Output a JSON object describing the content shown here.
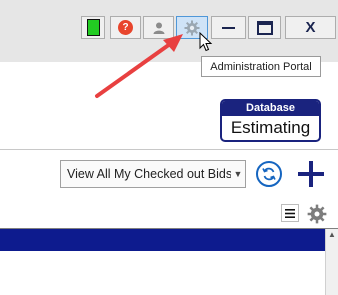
{
  "titlebar": {
    "buttons": {
      "status": {
        "color": "#22cc22"
      },
      "help": {
        "glyph": "?",
        "color": "#e8452c"
      },
      "user": {
        "icon": "user-icon"
      },
      "admin": {
        "icon": "gear-icon"
      },
      "minimize": {
        "glyph": "—"
      },
      "maximize": {
        "icon": "window-icon"
      },
      "close": {
        "glyph": "X"
      }
    }
  },
  "tooltip": {
    "text": "Administration Portal"
  },
  "database": {
    "header": "Database",
    "value": "Estimating"
  },
  "toolbar": {
    "view_select": {
      "selected": "View All My Checked out Bids"
    },
    "refresh_icon": "refresh-icon",
    "add_icon": "plus-icon",
    "menu_icon": "hamburger-icon",
    "settings_icon": "gear-icon"
  },
  "colors": {
    "accent_navy": "#1a237e",
    "grid_header": "#0d1b8e",
    "annotation_arrow": "#e84040",
    "refresh_blue": "#1565c0"
  }
}
